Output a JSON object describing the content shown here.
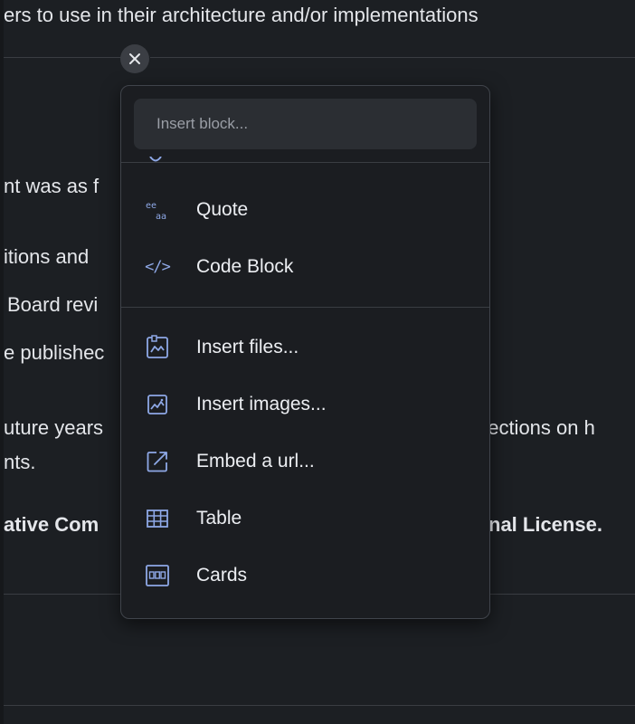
{
  "background": {
    "lines": [
      "ers to use in their architecture and/or implementations",
      "nt was as f",
      "itions and",
      "Board revi",
      "e publishec",
      "uture years",
      "irections on h",
      "nts.",
      "ative Com",
      "nal License."
    ]
  },
  "close_button": {
    "icon": "close-icon"
  },
  "insert_menu": {
    "search": {
      "placeholder": "Insert block..."
    },
    "items": [
      {
        "label": "Quote",
        "icon": "quote-icon"
      },
      {
        "label": "Code Block",
        "icon": "code-icon"
      },
      {
        "label": "Insert files...",
        "icon": "file-icon"
      },
      {
        "label": "Insert images...",
        "icon": "image-icon"
      },
      {
        "label": "Embed a url...",
        "icon": "embed-icon"
      },
      {
        "label": "Table",
        "icon": "table-icon"
      },
      {
        "label": "Cards",
        "icon": "cards-icon"
      }
    ]
  },
  "colors": {
    "background": "#1c1f23",
    "popup": "#1b1d21",
    "search_field": "#2b2e33",
    "icon_accent": "#8ea8e6",
    "text": "#eceef2"
  }
}
